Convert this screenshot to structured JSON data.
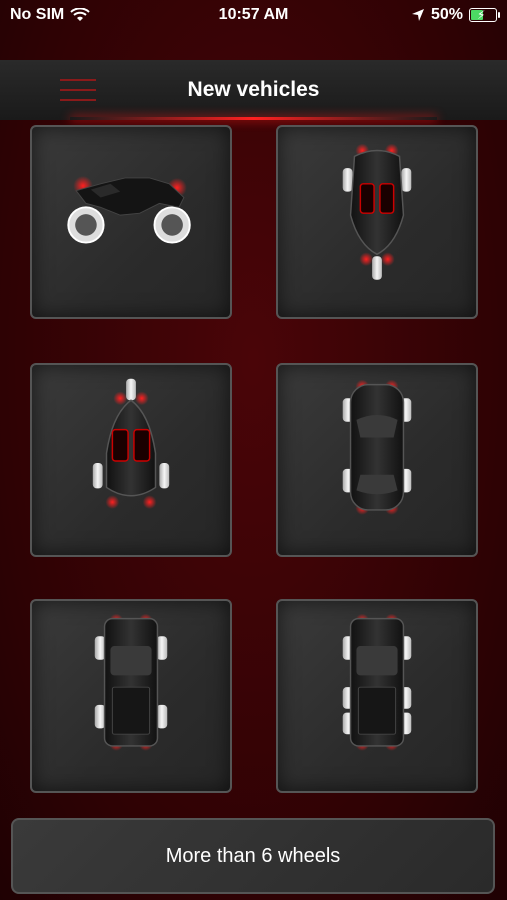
{
  "status": {
    "carrier": "No SIM",
    "time": "10:57 AM",
    "battery_percent": "50%",
    "battery_level": 0.5
  },
  "nav": {
    "title": "New vehicles"
  },
  "vehicles": [
    {
      "icon": "motorcycle-icon"
    },
    {
      "icon": "trike-two-front-icon"
    },
    {
      "icon": "trike-one-front-icon"
    },
    {
      "icon": "car-icon"
    },
    {
      "icon": "pickup-truck-icon"
    },
    {
      "icon": "six-wheel-truck-icon"
    }
  ],
  "more_button": {
    "label": "More than 6 wheels"
  },
  "colors": {
    "background": "#3a0305",
    "glow": "#ff2020"
  }
}
